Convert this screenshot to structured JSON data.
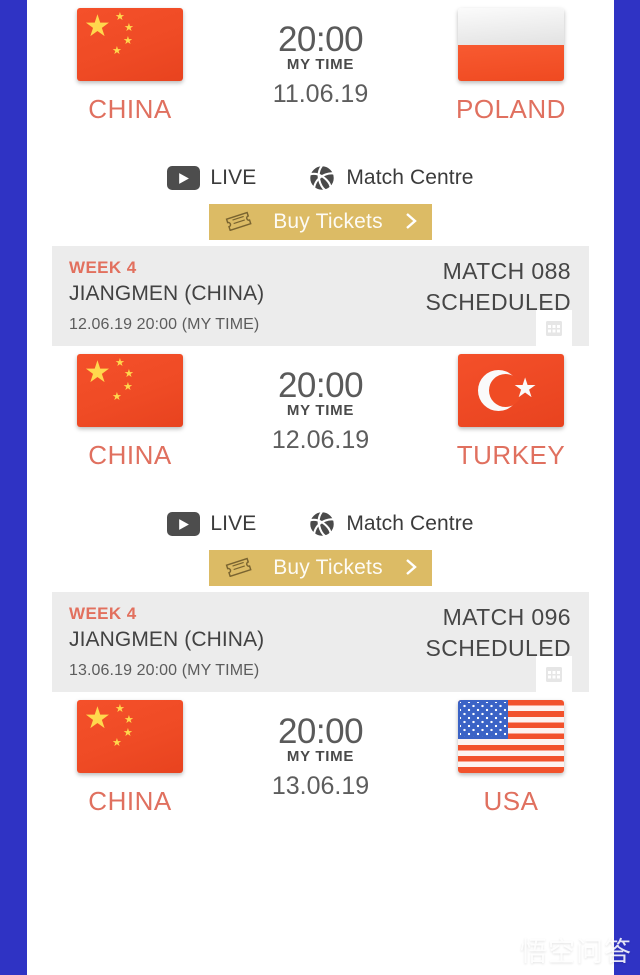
{
  "theme": {
    "page_background": "#ffffff",
    "outer_border": "#2f33c4",
    "team_name_color": "#e0705f",
    "accent_gold": "#dcbb65",
    "band_background": "#ececec",
    "week_color": "#e2705e"
  },
  "matches": [
    {
      "home": {
        "name": "CHINA",
        "flag": "china-flag"
      },
      "away": {
        "name": "POLAND",
        "flag": "poland-flag"
      },
      "time": "20:00",
      "time_label": "MY TIME",
      "date": "11.06.19",
      "actions": {
        "live_label": "LIVE",
        "live_icon": "play-icon",
        "match_centre_label": "Match Centre",
        "match_centre_icon": "volleyball-icon",
        "tickets_label": "Buy Tickets",
        "tickets_icon": "ticket-icon",
        "tickets_chevron": "chevron-right-icon"
      }
    },
    {
      "home": {
        "name": "CHINA",
        "flag": "china-flag"
      },
      "away": {
        "name": "TURKEY",
        "flag": "turkey-flag"
      },
      "time": "20:00",
      "time_label": "MY TIME",
      "date": "12.06.19",
      "actions": {
        "live_label": "LIVE",
        "live_icon": "play-icon",
        "match_centre_label": "Match Centre",
        "match_centre_icon": "volleyball-icon",
        "tickets_label": "Buy Tickets",
        "tickets_icon": "ticket-icon",
        "tickets_chevron": "chevron-right-icon"
      }
    },
    {
      "home": {
        "name": "CHINA",
        "flag": "china-flag"
      },
      "away": {
        "name": "USA",
        "flag": "usa-flag"
      },
      "time": "20:00",
      "time_label": "MY TIME",
      "date": "13.06.19"
    }
  ],
  "info_bands": [
    {
      "week": "WEEK 4",
      "venue": "JIANGMEN (CHINA)",
      "datetime": "12.06.19 20:00 (MY TIME)",
      "match_number": "MATCH 088",
      "status": "SCHEDULED",
      "calendar_icon": "calendar-icon"
    },
    {
      "week": "WEEK 4",
      "venue": "JIANGMEN (CHINA)",
      "datetime": "13.06.19 20:00 (MY TIME)",
      "match_number": "MATCH 096",
      "status": "SCHEDULED",
      "calendar_icon": "calendar-icon"
    }
  ],
  "watermark": {
    "text": "悟空问答"
  }
}
